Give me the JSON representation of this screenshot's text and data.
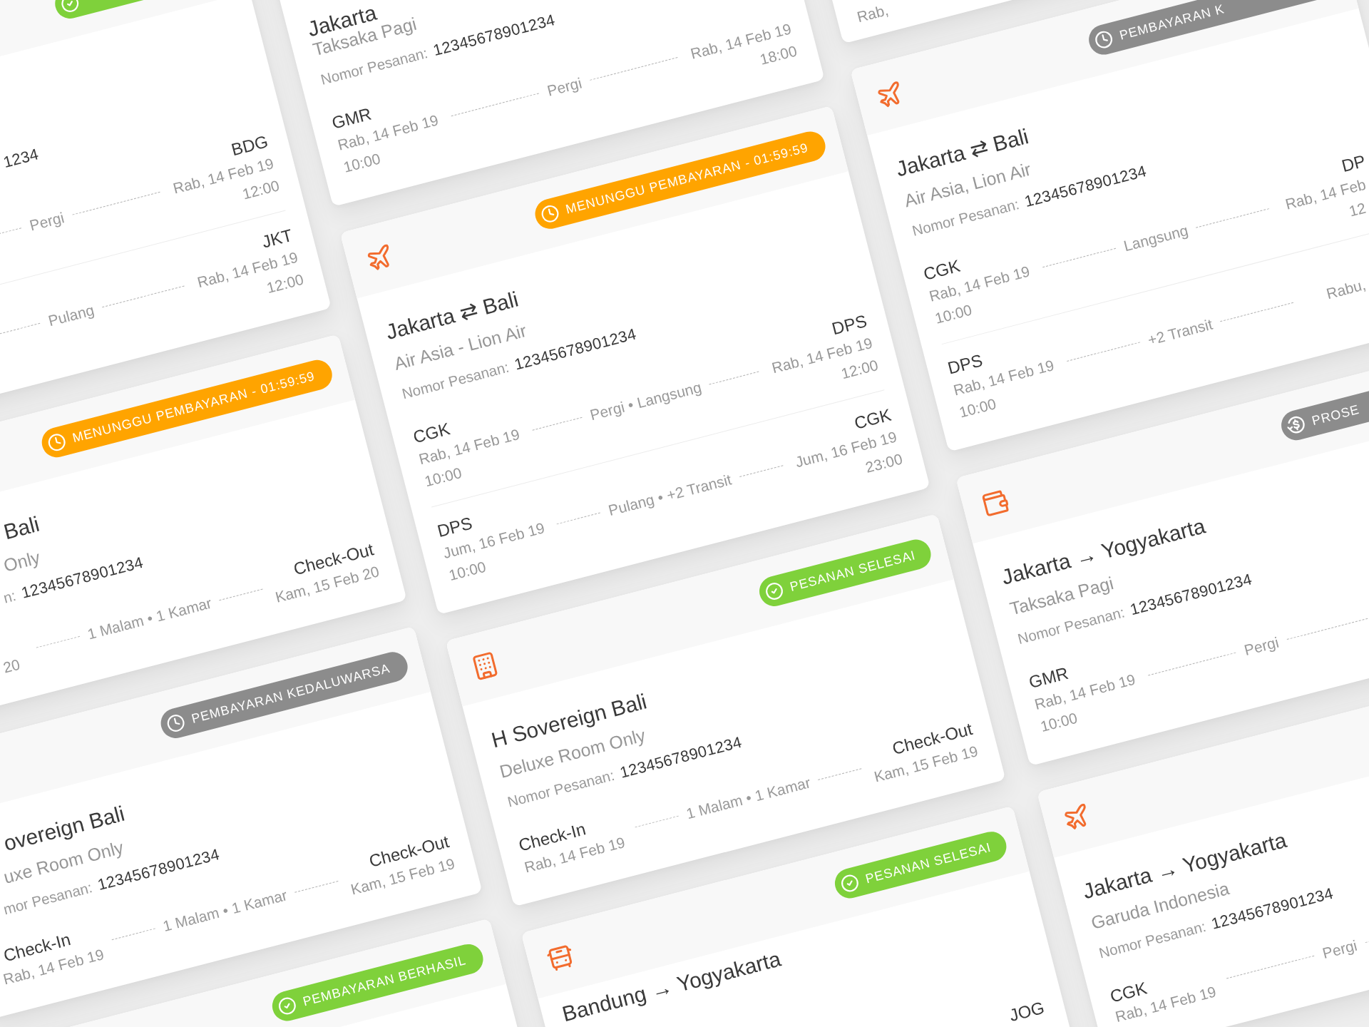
{
  "columns": [
    {
      "cards": [
        {
          "status": {
            "kind": "done"
          },
          "order_number": "1234",
          "rows": [
            {
              "note": "Pergi",
              "to": {
                "code": "BDG",
                "date": "Rab, 14 Feb 19",
                "time": "12:00"
              }
            },
            {
              "note": "Pulang",
              "to": {
                "code": "JKT",
                "date": "Rab, 14 Feb 19",
                "time": "12:00"
              }
            }
          ]
        },
        {
          "status": {
            "kind": "waiting",
            "label": "MENUNGGU PEMBAYARAN - 01:59:59"
          },
          "title": "Bali",
          "subtitle": "Only",
          "order_label": "n:",
          "order_number": "12345678901234",
          "rows": [
            {
              "from": {
                "date": "20"
              },
              "note": "1 Malam • 1 Kamar",
              "to": {
                "code": "Check-Out",
                "date": "Kam, 15 Feb 20"
              }
            }
          ]
        },
        {
          "status": {
            "kind": "expired",
            "label": "PEMBAYARAN KEDALUWARSA"
          },
          "title": "overeign Bali",
          "subtitle": "uxe Room Only",
          "order_label": "mor Pesanan:",
          "order_number": "12345678901234",
          "rows": [
            {
              "from": {
                "code": "Check-In",
                "date": "Rab, 14 Feb 19"
              },
              "note": "1 Malam • 1 Kamar",
              "to": {
                "code": "Check-Out",
                "date": "Kam, 15 Feb 19"
              }
            }
          ]
        },
        {
          "status": {
            "kind": "paid",
            "label": "PEMBAYARAN BERHASIL"
          }
        }
      ]
    },
    {
      "cards": [
        {
          "title": "Jakarta",
          "subtitle": "Taksaka Pagi",
          "order_label": "Nomor Pesanan:",
          "order_number": "12345678901234",
          "rows": [
            {
              "from": {
                "code": "GMR",
                "date": "Rab, 14 Feb 19",
                "time": "10:00"
              },
              "note": "Pergi",
              "to": {
                "date": "Rab, 14 Feb 19",
                "time": "18:00"
              }
            }
          ]
        },
        {
          "kind": "flight",
          "status": {
            "kind": "waiting",
            "label": "MENUNGGU PEMBAYARAN - 01:59:59"
          },
          "title": "Jakarta ⇄ Bali",
          "subtitle": "Air Asia - Lion Air",
          "order_label": "Nomor Pesanan:",
          "order_number": "12345678901234",
          "rows": [
            {
              "from": {
                "code": "CGK",
                "date": "Rab, 14 Feb 19",
                "time": "10:00"
              },
              "note": "Pergi • Langsung",
              "to": {
                "code": "DPS",
                "date": "Rab, 14 Feb 19",
                "time": "12:00"
              }
            },
            {
              "from": {
                "code": "DPS",
                "date": "Jum, 16 Feb 19",
                "time": "10:00"
              },
              "note": "Pulang • +2 Transit",
              "to": {
                "code": "CGK",
                "date": "Jum, 16 Feb 19",
                "time": "23:00"
              }
            }
          ]
        },
        {
          "kind": "hotel",
          "status": {
            "kind": "done",
            "label": "PESANAN SELESAI"
          },
          "title": "H Sovereign Bali",
          "subtitle": "Deluxe Room Only",
          "order_label": "Nomor Pesanan:",
          "order_number": "12345678901234",
          "rows": [
            {
              "from": {
                "code": "Check-In",
                "date": "Rab, 14 Feb 19"
              },
              "note": "1 Malam • 1 Kamar",
              "to": {
                "code": "Check-Out",
                "date": "Kam, 15 Feb 19"
              }
            }
          ]
        },
        {
          "kind": "bus",
          "status": {
            "kind": "done",
            "label": "PESANAN SELESAI"
          },
          "title": "Bandung → Yogyakarta",
          "rows": [
            {
              "to": {
                "code": "JOG"
              }
            }
          ]
        }
      ]
    },
    {
      "cards": [
        {
          "rows": [
            {
              "from": {
                "date": "Rab,"
              }
            }
          ]
        },
        {
          "kind": "flight",
          "status": {
            "kind": "expired",
            "label": "PEMBAYARAN K"
          },
          "title": "Jakarta ⇄ Bali",
          "subtitle": "Air Asia, Lion Air",
          "order_label": "Nomor Pesanan:",
          "order_number": "12345678901234",
          "rows": [
            {
              "from": {
                "code": "CGK",
                "date": "Rab, 14 Feb 19",
                "time": "10:00"
              },
              "note": "Langsung",
              "to": {
                "code": "DP",
                "date": "Rab, 14 Feb",
                "time": "12"
              }
            },
            {
              "from": {
                "code": "DPS",
                "date": "Rab, 14 Feb 19",
                "time": "10:00"
              },
              "note": "+2 Transit",
              "to": {
                "date": "Rabu,"
              }
            }
          ]
        },
        {
          "kind": "train",
          "status": {
            "kind": "refund",
            "label": "PROSE"
          },
          "title": "Jakarta → Yogyakarta",
          "subtitle": "Taksaka Pagi",
          "order_label": "Nomor Pesanan:",
          "order_number": "12345678901234",
          "rows": [
            {
              "from": {
                "code": "GMR",
                "date": "Rab, 14 Feb 19",
                "time": "10:00"
              },
              "note": "Pergi"
            }
          ]
        },
        {
          "kind": "flight",
          "title": "Jakarta → Yogyakarta",
          "subtitle": "Garuda Indonesia",
          "order_label": "Nomor Pesanan:",
          "order_number": "12345678901234",
          "rows": [
            {
              "from": {
                "code": "CGK",
                "date": "Rab, 14 Feb 19"
              },
              "note": "Pergi"
            }
          ]
        }
      ]
    }
  ]
}
